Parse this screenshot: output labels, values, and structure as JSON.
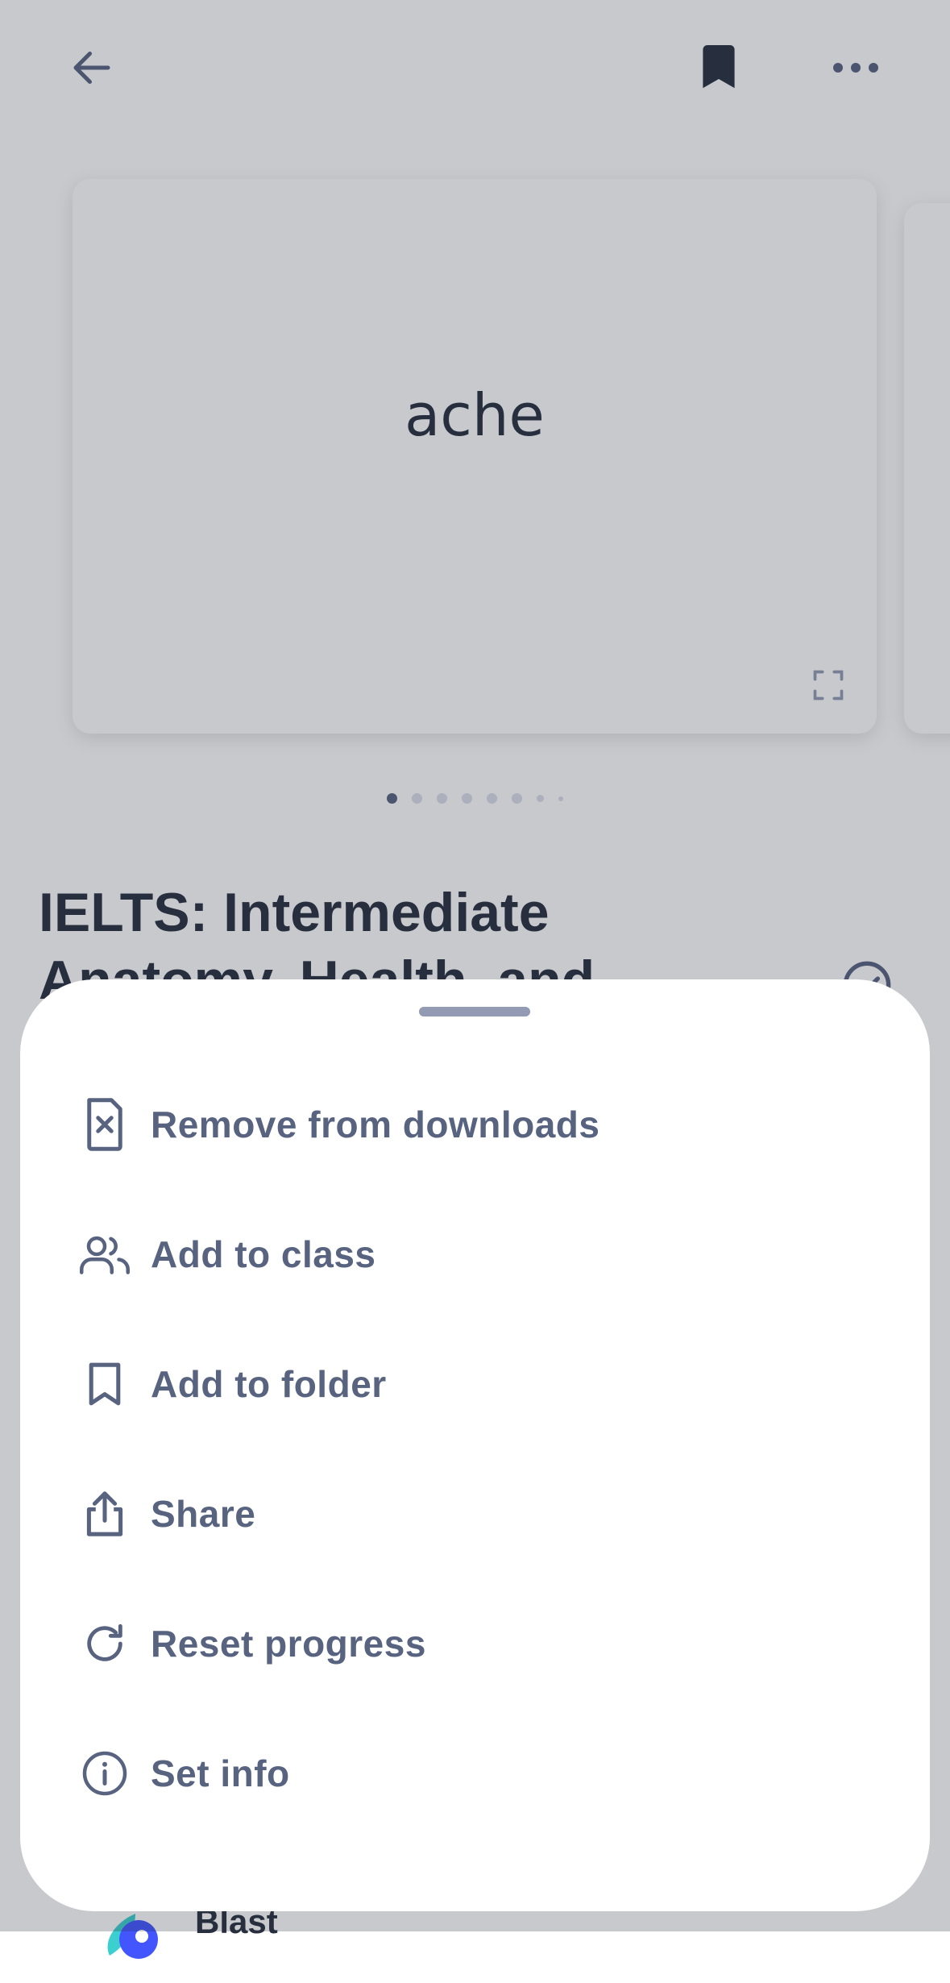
{
  "card": {
    "term": "ache",
    "dot_count": 8,
    "active_dot": 1
  },
  "set": {
    "title": "IELTS: Intermediate Anatomy, Health, and"
  },
  "study_modes": {
    "blast_label": "Blast"
  },
  "sheet": {
    "items": [
      {
        "label": "Remove from downloads",
        "icon": "remove-download-icon"
      },
      {
        "label": "Add to class",
        "icon": "people-icon"
      },
      {
        "label": "Add to folder",
        "icon": "bookmark-outline-icon"
      },
      {
        "label": "Share",
        "icon": "share-icon"
      },
      {
        "label": "Reset progress",
        "icon": "reset-icon"
      },
      {
        "label": "Set info",
        "icon": "info-icon"
      }
    ]
  },
  "colors": {
    "text_primary": "#282e3e",
    "text_secondary": "#586380",
    "handle": "#939bb4",
    "scrim": "rgba(40,46,62,0.26)"
  }
}
